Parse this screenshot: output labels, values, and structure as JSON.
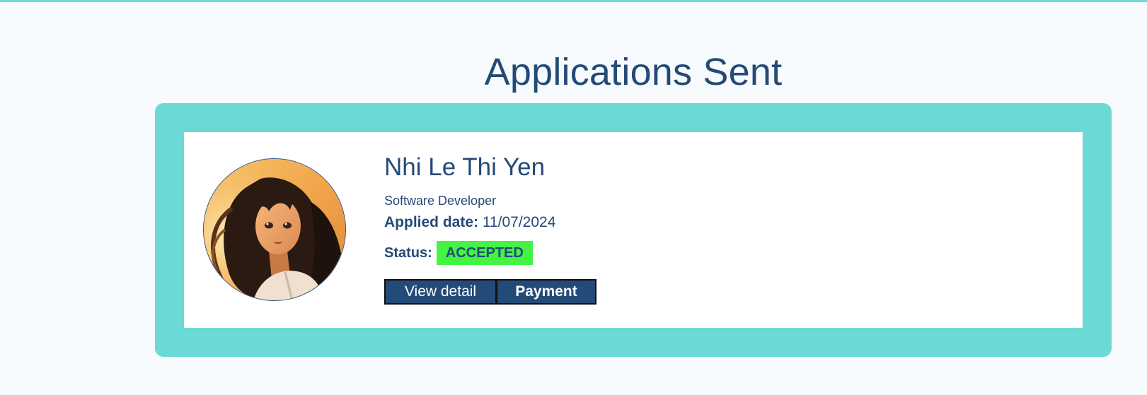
{
  "page": {
    "title": "Applications Sent"
  },
  "colors": {
    "accent": "#6bdad6",
    "primary": "#244a78",
    "status_accepted": "#44f444",
    "background": "#f7fbfe"
  },
  "application": {
    "avatar_icon": "user-avatar-illustration",
    "name": "Nhi Le Thi Yen",
    "role": "Software Developer",
    "applied_label": "Applied date:",
    "applied_date": "11/07/2024",
    "status_label": "Status:",
    "status_value": "ACCEPTED",
    "view_detail_label": "View detail",
    "payment_label": "Payment"
  }
}
